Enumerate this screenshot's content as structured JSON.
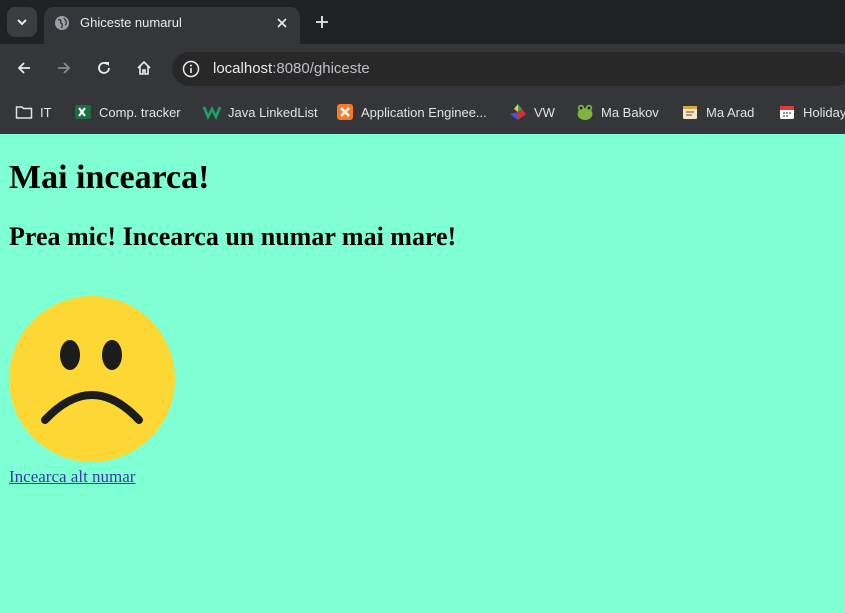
{
  "browser": {
    "tab": {
      "title": "Ghiceste numarul",
      "favicon": "globe-icon"
    },
    "address": {
      "host": "localhost",
      "path": ":8080/ghiceste"
    },
    "bookmarks": [
      {
        "label": "IT",
        "icon": "folder-icon"
      },
      {
        "label": "Comp. tracker",
        "icon": "excel-icon"
      },
      {
        "label": "Java LinkedList",
        "icon": "w-icon"
      },
      {
        "label": "Application Enginee...",
        "icon": "xampp-icon"
      },
      {
        "label": "VW",
        "icon": "diamond-icon"
      },
      {
        "label": "Ma Bakov",
        "icon": "frog-icon"
      },
      {
        "label": "Ma Arad",
        "icon": "notepad-icon"
      },
      {
        "label": "Holiday",
        "icon": "calendar-icon"
      }
    ]
  },
  "page": {
    "heading": "Mai incearca!",
    "message": "Prea mic! Incearca un numar mai mare!",
    "image": "sad-face-icon",
    "link_label": "Incearca alt numar"
  },
  "colors": {
    "page_background": "#7fffd4",
    "face": "#fdd835",
    "link": "#3b3aa3",
    "chrome_dark": "#202124",
    "chrome": "#35363a"
  }
}
